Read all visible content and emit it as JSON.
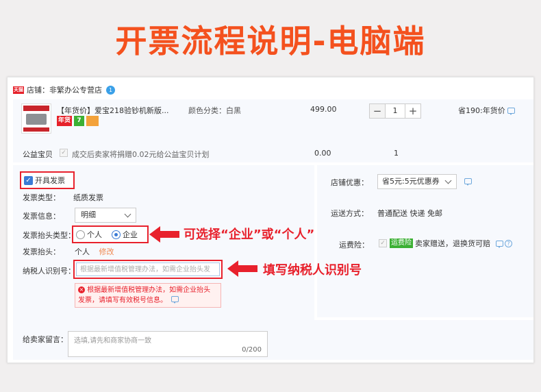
{
  "headline": "开票流程说明-电脑端",
  "shop": {
    "icon_text": "天猫",
    "label": "店铺：非繁办公专营店",
    "badge": "1"
  },
  "product": {
    "title": "【年货价】爱宝218验钞机新版...",
    "color_category": "颜色分类：白黑",
    "tag_nian": "年货",
    "tag_seven": "7",
    "price": "499.00",
    "qty_minus": "−",
    "qty_value": "1",
    "qty_plus": "+",
    "saving": "省190:年货价"
  },
  "charity": {
    "label": "公益宝贝",
    "text": "成交后卖家将捐赠0.02元给公益宝贝计划",
    "price": "0.00",
    "qty": "1"
  },
  "invoice": {
    "toggle_label": "开具发票",
    "type_label": "发票类型：",
    "type_value": "纸质发票",
    "info_label": "发票信息：",
    "info_value": "明细",
    "header_type_label": "发票抬头类型：",
    "option_personal": "个人",
    "option_company": "企业",
    "header_label": "发票抬头：",
    "header_value": "个人",
    "edit_link": "修改",
    "tax_label": "纳税人识别号：",
    "tax_placeholder": "根据最新增值税管理办法，如需企业抬头发",
    "error_line1": "根据最新增值税管理办法，如需企业抬头",
    "error_line2": "发票，请填写有效税号信息。"
  },
  "right": {
    "coupon_label": "店铺优惠：",
    "coupon_value": "省5元:5元优惠券",
    "shipping_label": "运送方式：",
    "shipping_value": "普通配送 快递 免邮",
    "insurance_label": "运费险：",
    "insurance_tag": "运费险",
    "insurance_text": "卖家赠送，退换货可赔",
    "help": "?"
  },
  "message": {
    "label": "给卖家留言：",
    "placeholder": "选填,请先和商家协商一致",
    "counter": "0/200"
  },
  "annotations": {
    "choose": "可选择“企业”或“个人”",
    "fill": "填写纳税人识别号"
  },
  "colors": {
    "headline": "#f4511e",
    "annotation_red": "#e8212c",
    "accent_blue": "#3a7bd5"
  }
}
